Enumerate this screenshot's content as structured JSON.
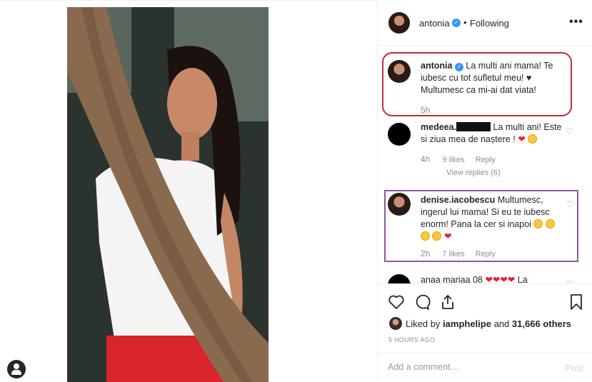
{
  "header": {
    "username": "antonia",
    "separator": "•",
    "follow_state": "Following",
    "more": "•••"
  },
  "comments": [
    {
      "username": "antonia",
      "text": "La multi ani mama! Te iubesc cu tot sufletul meu! ♥ Multumesc ca mi-ai dat viata!",
      "time": "5h"
    },
    {
      "username": "medeea.",
      "text_a": "La multi ani! Este si ziua mea de naștere !",
      "time": "4h",
      "likes": "9 likes",
      "reply": "Reply",
      "view_replies": "View replies (6)"
    },
    {
      "username": "denise.iacobescu",
      "text": "Multumesc, ingerul lui mama! Si eu te iubesc enorm! Pana la cer si inapoi",
      "time": "2h",
      "likes": "7 likes",
      "reply": "Reply"
    },
    {
      "username": "anaa mariaa 08",
      "text": "La"
    }
  ],
  "footer": {
    "liked_prefix": "Liked by",
    "liked_user": "iamphelipe",
    "liked_and": "and",
    "liked_count": "31,666 others",
    "timestamp": "5 HOURS AGO",
    "comment_placeholder": "Add a comment…",
    "post_label": "Post"
  },
  "colors": {
    "verified": "#3897f0",
    "highlight_red": "#c22c3a",
    "highlight_purple": "#8a5aa0",
    "post_disabled": "#b2dffc"
  }
}
